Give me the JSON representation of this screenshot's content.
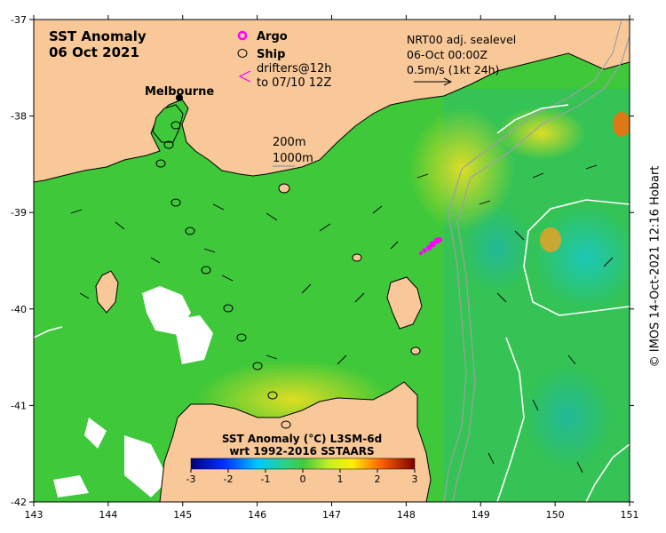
{
  "map": {
    "title": "SST Anomaly",
    "date": "06 Oct 2021",
    "place_label": "Melbourne",
    "legend": {
      "argo": "Argo",
      "ship": "Ship",
      "drifters_line1": "drifters@12h",
      "drifters_line2": "to 07/10 12Z"
    },
    "contours": {
      "c200": "200m",
      "c1000": "1000m"
    },
    "current_key": {
      "line1": "NRT00 adj. sealevel",
      "line2": "06-Oct 00:00Z",
      "line3": "0.5m/s (1kt 24h)"
    },
    "colorbar": {
      "title1": "SST Anomaly (°C) L3SM-6d",
      "title2": "wrt 1992-2016 SSTAARS",
      "ticks": [
        "-3",
        "-2",
        "-1",
        "0",
        "1",
        "2",
        "3"
      ]
    },
    "lon_ticks": [
      "143",
      "144",
      "145",
      "146",
      "147",
      "148",
      "149",
      "150",
      "151"
    ],
    "lat_ticks": [
      "-37",
      "-38",
      "-39",
      "-40",
      "-41",
      "-42"
    ],
    "credit": "© IMOS 14-Oct-2021 12:16 Hobart",
    "colors": {
      "land": "#f8c898",
      "anom_green": "#3ec83a",
      "argo": "#ff00ff"
    }
  }
}
